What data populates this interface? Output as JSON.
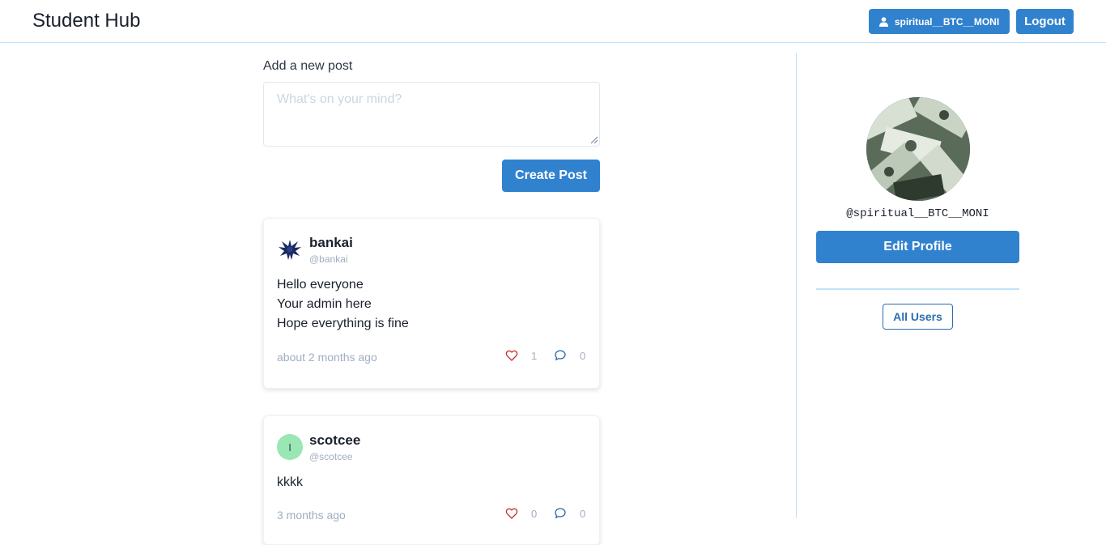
{
  "header": {
    "brand": "Student Hub",
    "user_button_label": "spiritual__BTC__MONI",
    "logout_label": "Logout"
  },
  "compose": {
    "label": "Add a new post",
    "placeholder": "What's on your mind?",
    "submit_label": "Create Post"
  },
  "posts": [
    {
      "name": "bankai",
      "handle": "@bankai",
      "lines": [
        "Hello everyone",
        "Your admin here",
        "Hope everything is fine"
      ],
      "time": "about 2 months ago",
      "likes": "1",
      "comments": "0"
    },
    {
      "name": "scotcee",
      "handle": "@scotcee",
      "avatar_initial": "I",
      "lines": [
        "kkkk"
      ],
      "time": "3 months ago",
      "likes": "0",
      "comments": "0"
    }
  ],
  "sidebar": {
    "handle": "@spiritual__BTC__MONI",
    "edit_profile_label": "Edit Profile",
    "all_users_label": "All Users"
  },
  "colors": {
    "primary": "#3182ce",
    "like": "#e53e3e",
    "comment": "#3182ce",
    "divider": "#bee3f8"
  }
}
